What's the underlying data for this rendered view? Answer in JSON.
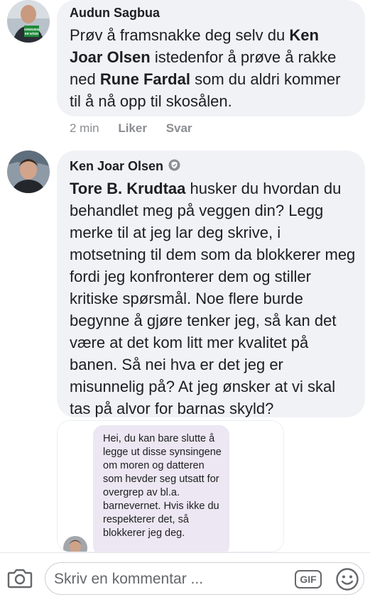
{
  "comments": [
    {
      "author": "Audun Sagbua",
      "avatar_badge": "GRENSEN ER NÅDD",
      "text_parts": [
        {
          "text": "Prøv å framsnakke deg selv du ",
          "bold": false
        },
        {
          "text": "Ken Joar Olsen",
          "bold": true
        },
        {
          "text": " istedenfor å prøve å rakke ned ",
          "bold": false
        },
        {
          "text": "Rune Fardal",
          "bold": true
        },
        {
          "text": " som du aldri kommer til å nå opp til skosålen.",
          "bold": false
        }
      ],
      "time": "2 min",
      "like_label": "Liker",
      "reply_label": "Svar"
    },
    {
      "author": "Ken Joar Olsen",
      "verified_icon": "shield-badge-icon",
      "text_parts": [
        {
          "text": "Tore B. Krudtaa",
          "bold": true
        },
        {
          "text": " husker du hvordan du behandlet meg på veggen din? Legg merke til at jeg lar deg skrive, i motsetning til dem som da blokkerer meg fordi jeg konfronterer dem og stiller kritiske spørsmål. Noe flere burde begynne å gjøre tenker jeg, så kan det være at det kom litt mer kvalitet på banen. Så nei hva er det jeg er misunnelig på? At jeg ønsker at vi skal tas på alvor for barnas skyld?",
          "bold": false
        }
      ]
    }
  ],
  "attached_screenshot": {
    "message": "Hei, du kan bare slutte å legge ut disse synsingene om moren og datteren som hevder seg utsatt for overgrep av bl.a. barnevernet. Hvis ikke du respekterer det, så blokkerer jeg deg."
  },
  "composer": {
    "placeholder": "Skriv en kommentar ...",
    "gif_label": "GIF",
    "camera_icon": "camera-icon",
    "emoji_icon": "emoji-smile-icon"
  },
  "colors": {
    "bubble": "#f0f2f5",
    "meta": "#8a8d91",
    "chat_bubble": "#ece7f2",
    "text": "#1c1e21"
  }
}
